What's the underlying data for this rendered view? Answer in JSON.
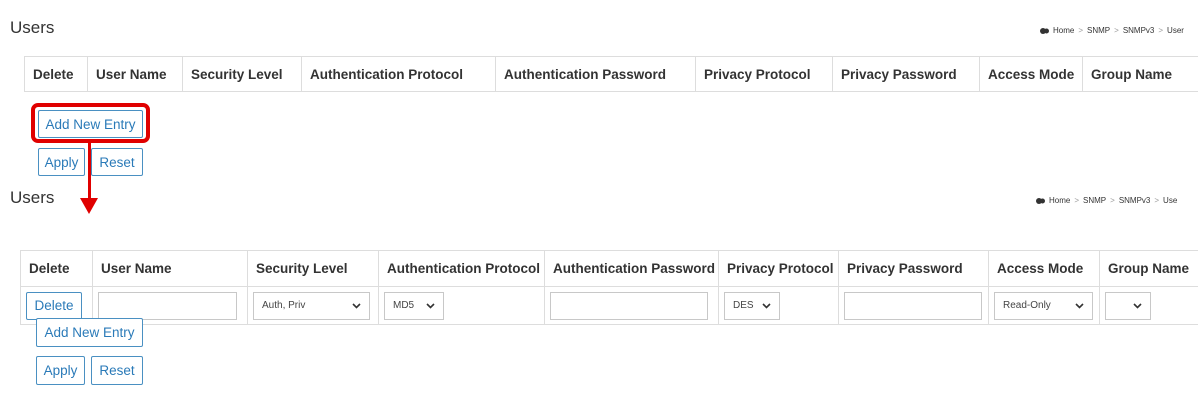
{
  "accent_color": "#2a7ab8",
  "annotation_color": "#e00000",
  "breadcrumb": {
    "home": "Home",
    "snmp": "SNMP",
    "snmpv3": "SNMPv3",
    "users_truncated_top": "User",
    "users_truncated_bottom": "Use",
    "separator": ">"
  },
  "panel_top": {
    "title": "Users",
    "columns": [
      "Delete",
      "User Name",
      "Security Level",
      "Authentication Protocol",
      "Authentication Password",
      "Privacy Protocol",
      "Privacy Password",
      "Access Mode",
      "Group Name"
    ],
    "add_label": "Add New Entry",
    "apply_label": "Apply",
    "reset_label": "Reset"
  },
  "panel_bottom": {
    "title": "Users",
    "columns": [
      "Delete",
      "User Name",
      "Security Level",
      "Authentication Protocol",
      "Authentication Password",
      "Privacy Protocol",
      "Privacy Password",
      "Access Mode",
      "Group Name"
    ],
    "row": {
      "delete_label": "Delete",
      "user_name": "",
      "security_level": "Auth, Priv",
      "auth_protocol": "MD5",
      "auth_password": "",
      "privacy_protocol": "DES",
      "privacy_password": "",
      "access_mode": "Read-Only",
      "group_name": ""
    },
    "add_label": "Add New Entry",
    "apply_label": "Apply",
    "reset_label": "Reset"
  }
}
